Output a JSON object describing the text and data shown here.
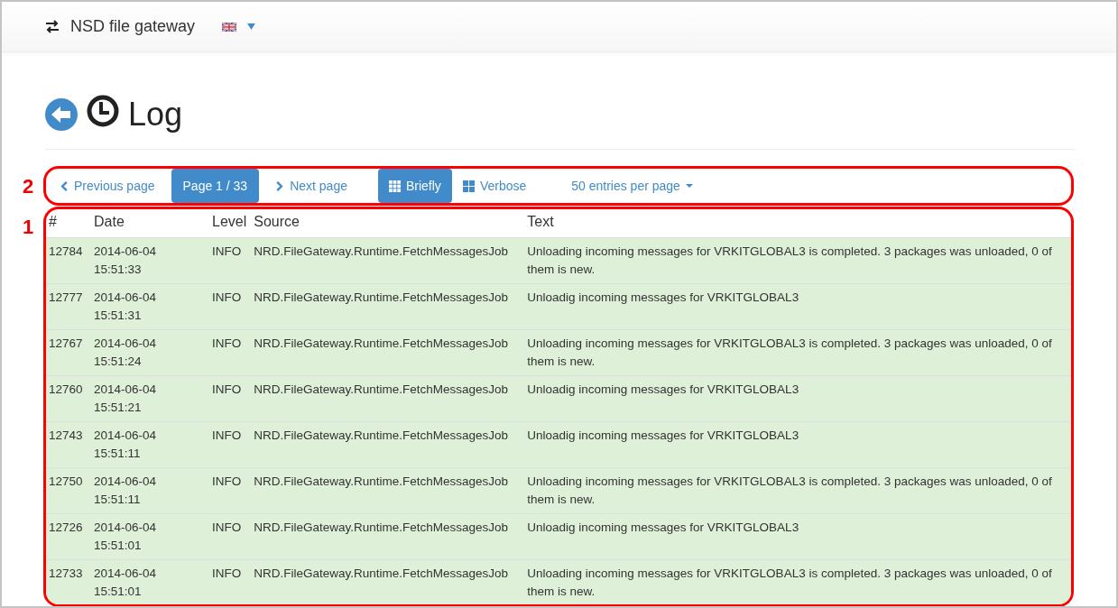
{
  "navbar": {
    "brand": "NSD file gateway"
  },
  "page": {
    "title": "Log"
  },
  "callouts": [
    "2",
    "1"
  ],
  "toolbar": [
    {
      "kind": "prev",
      "label": "Previous page",
      "selected": false
    },
    {
      "kind": "page",
      "label": "Page 1 / 33",
      "selected": true
    },
    {
      "kind": "next",
      "label": "Next page",
      "selected": false
    },
    {
      "kind": "view-brief",
      "label": "Briefly",
      "selected": true
    },
    {
      "kind": "view-verbose",
      "label": "Verbose",
      "selected": false
    },
    {
      "kind": "dropdown",
      "label": "50 entries per page",
      "selected": false
    }
  ],
  "table": {
    "columns": [
      "#",
      "Date",
      "Level",
      "Source",
      "Text"
    ],
    "rows": [
      {
        "color": "#dff0d8",
        "cells": [
          "12784",
          "2014-06-04 15:51:33",
          "INFO",
          "NRD.FileGateway.Runtime.FetchMessagesJob",
          "Unloading incoming messages for VRKITGLOBAL3 is completed. 3 packages was unloaded, 0 of them is new."
        ]
      },
      {
        "color": "#dff0d8",
        "cells": [
          "12777",
          "2014-06-04 15:51:31",
          "INFO",
          "NRD.FileGateway.Runtime.FetchMessagesJob",
          "Unloadig incoming messages for VRKITGLOBAL3"
        ]
      },
      {
        "color": "#dff0d8",
        "cells": [
          "12767",
          "2014-06-04 15:51:24",
          "INFO",
          "NRD.FileGateway.Runtime.FetchMessagesJob",
          "Unloading incoming messages for VRKITGLOBAL3 is completed. 3 packages was unloaded, 0 of them is new."
        ]
      },
      {
        "color": "#dff0d8",
        "cells": [
          "12760",
          "2014-06-04 15:51:21",
          "INFO",
          "NRD.FileGateway.Runtime.FetchMessagesJob",
          "Unloadig incoming messages for VRKITGLOBAL3"
        ]
      },
      {
        "color": "#dff0d8",
        "cells": [
          "12743",
          "2014-06-04 15:51:11",
          "INFO",
          "NRD.FileGateway.Runtime.FetchMessagesJob",
          "Unloadig incoming messages for VRKITGLOBAL3"
        ]
      },
      {
        "color": "#dff0d8",
        "cells": [
          "12750",
          "2014-06-04 15:51:11",
          "INFO",
          "NRD.FileGateway.Runtime.FetchMessagesJob",
          "Unloading incoming messages for VRKITGLOBAL3 is completed. 3 packages was unloaded, 0 of them is new."
        ]
      },
      {
        "color": "#dff0d8",
        "cells": [
          "12726",
          "2014-06-04 15:51:01",
          "INFO",
          "NRD.FileGateway.Runtime.FetchMessagesJob",
          "Unloadig incoming messages for VRKITGLOBAL3"
        ]
      },
      {
        "color": "#dff0d8",
        "cells": [
          "12733",
          "2014-06-04 15:51:01",
          "INFO",
          "NRD.FileGateway.Runtime.FetchMessagesJob",
          "Unloading incoming messages for VRKITGLOBAL3 is completed. 3 packages was unloaded, 0 of them is new."
        ]
      }
    ]
  }
}
